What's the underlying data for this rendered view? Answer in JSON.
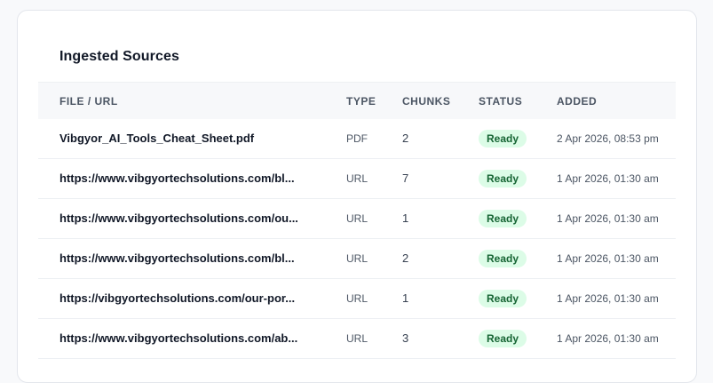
{
  "panel": {
    "title": "Ingested Sources"
  },
  "table": {
    "columns": {
      "name": "FILE / URL",
      "type": "TYPE",
      "chunks": "CHUNKS",
      "status": "STATUS",
      "added": "ADDED"
    },
    "rows": [
      {
        "name": "Vibgyor_AI_Tools_Cheat_Sheet.pdf",
        "type": "PDF",
        "chunks": "2",
        "status": "Ready",
        "added": "2 Apr 2026, 08:53 pm"
      },
      {
        "name": "https://www.vibgyortechsolutions.com/bl...",
        "type": "URL",
        "chunks": "7",
        "status": "Ready",
        "added": "1 Apr 2026, 01:30 am"
      },
      {
        "name": "https://www.vibgyortechsolutions.com/ou...",
        "type": "URL",
        "chunks": "1",
        "status": "Ready",
        "added": "1 Apr 2026, 01:30 am"
      },
      {
        "name": "https://www.vibgyortechsolutions.com/bl...",
        "type": "URL",
        "chunks": "2",
        "status": "Ready",
        "added": "1 Apr 2026, 01:30 am"
      },
      {
        "name": "https://vibgyortechsolutions.com/our-por...",
        "type": "URL",
        "chunks": "1",
        "status": "Ready",
        "added": "1 Apr 2026, 01:30 am"
      },
      {
        "name": "https://www.vibgyortechsolutions.com/ab...",
        "type": "URL",
        "chunks": "3",
        "status": "Ready",
        "added": "1 Apr 2026, 01:30 am"
      }
    ]
  },
  "colors": {
    "status_ready_bg": "#dcfce7",
    "status_ready_text": "#166534"
  }
}
